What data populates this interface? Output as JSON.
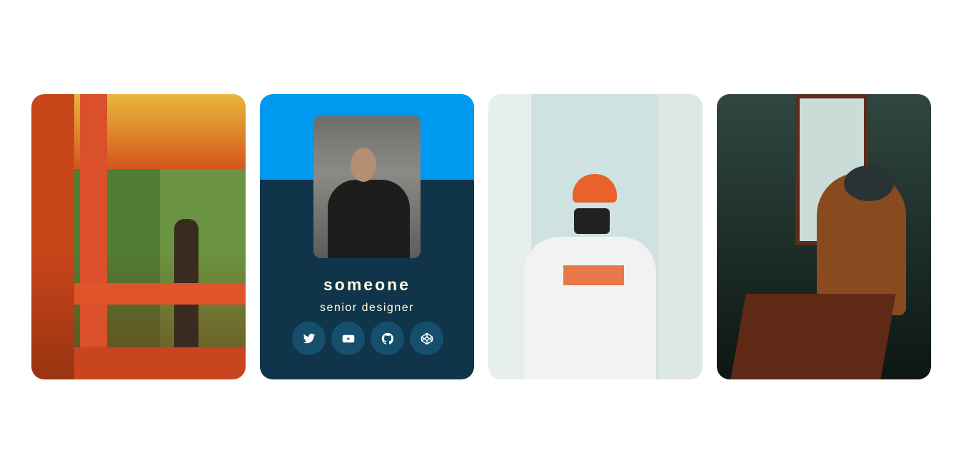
{
  "cards": [
    {
      "type": "photo",
      "alt": "man on red pagoda balcony"
    },
    {
      "type": "profile",
      "name": "someone",
      "role": "senior designer",
      "socials": [
        {
          "icon": "twitter-icon"
        },
        {
          "icon": "youtube-icon"
        },
        {
          "icon": "github-icon"
        },
        {
          "icon": "codepen-icon"
        }
      ],
      "colors": {
        "top": "#0099f0",
        "bottom": "#10344a",
        "button": "#164f6b",
        "text": "#fffde0"
      }
    },
    {
      "type": "photo",
      "alt": "man with camera and orange cap"
    },
    {
      "type": "photo",
      "alt": "woman drinking coffee by window"
    }
  ]
}
